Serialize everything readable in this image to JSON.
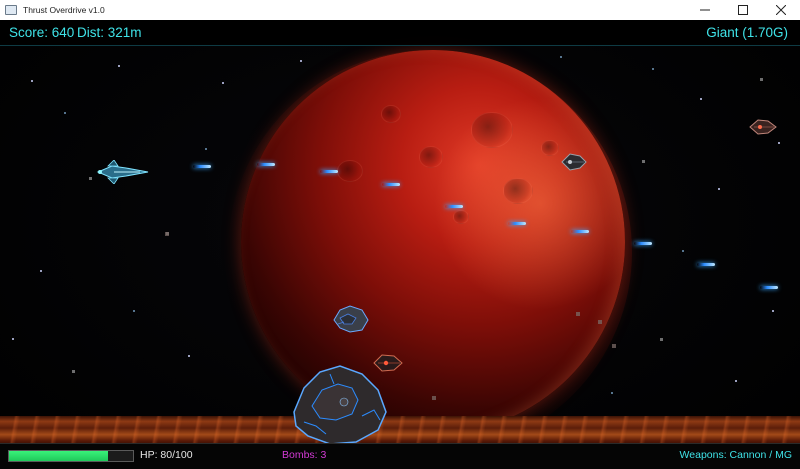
{
  "window": {
    "title": "Thrust Overdrive v1.0",
    "controls": [
      "minimize",
      "maximize",
      "close"
    ]
  },
  "hud": {
    "score_text": "Score: 640",
    "distance_text": "Dist: 321m",
    "gravity_text": "Giant (1.70G)",
    "hp_text": "HP: 80/100",
    "hp_fraction": 0.8,
    "bombs_text": "Bombs: 3",
    "weapons_text": "Weapons: Cannon / MG"
  },
  "colors": {
    "hud_cyan": "#3fe3e8",
    "hp_green": "#2be56f",
    "bombs_magenta": "#d23ad4",
    "bullet_blue": "#2c8cff",
    "planet_red": "#b81d12"
  },
  "scene": {
    "background": "starfield",
    "planet": "red-giant-planet",
    "ground": "molten-lava-ground",
    "player": "player-fighter-ship",
    "enemies": [
      "enemy-ship",
      "enemy-ship",
      "enemy-ship"
    ],
    "asteroids": [
      "small-asteroid",
      "large-asteroid"
    ]
  }
}
